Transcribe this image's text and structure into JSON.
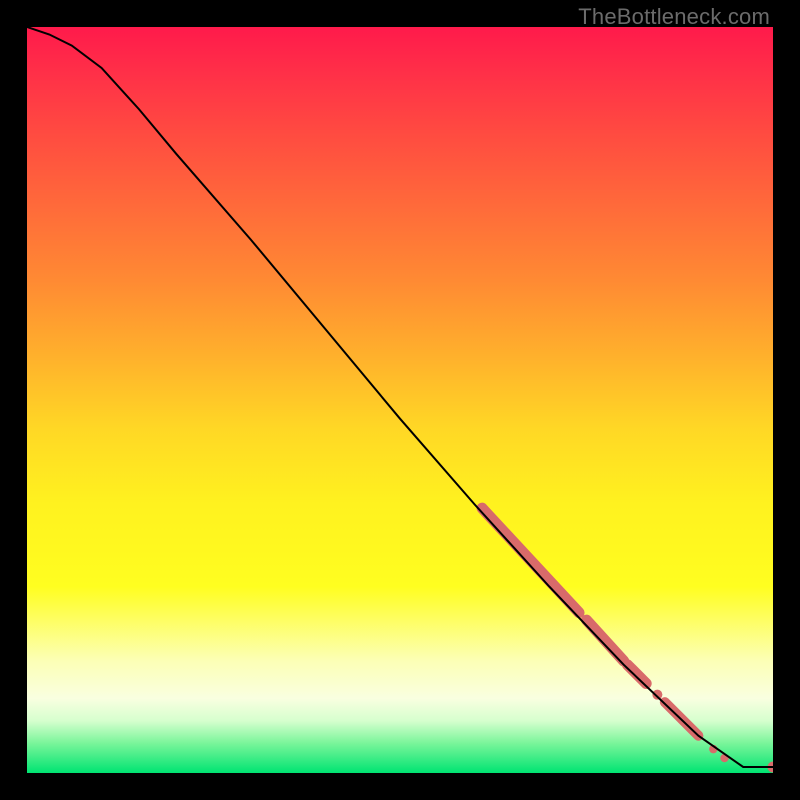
{
  "attribution": "TheBottleneck.com",
  "chart_data": {
    "type": "line",
    "title": "",
    "xlabel": "",
    "ylabel": "",
    "xlim": [
      0,
      100
    ],
    "ylim": [
      0,
      100
    ],
    "series": [
      {
        "name": "curve",
        "x": [
          0,
          3,
          6,
          10,
          15,
          20,
          30,
          40,
          50,
          60,
          70,
          80,
          90,
          96,
          100
        ],
        "y": [
          100,
          99,
          97.5,
          94.5,
          89,
          83,
          71.5,
          59.5,
          47.5,
          36,
          25,
          14.5,
          5,
          0.8,
          0.8
        ]
      }
    ],
    "markers": [
      {
        "name": "segment",
        "x0": 61,
        "y0": 35.5,
        "x1": 74,
        "y1": 21.5,
        "radius": 5.5
      },
      {
        "name": "segment",
        "x0": 75,
        "y0": 20.5,
        "x1": 80,
        "y1": 15,
        "radius": 5.5
      },
      {
        "name": "segment",
        "x0": 80.5,
        "y0": 14.5,
        "x1": 83,
        "y1": 12,
        "radius": 5.5
      },
      {
        "name": "point",
        "x": 84.5,
        "y": 10.5,
        "radius": 5.0
      },
      {
        "name": "segment",
        "x0": 85.5,
        "y0": 9.5,
        "x1": 90,
        "y1": 5,
        "radius": 5.0
      },
      {
        "name": "point",
        "x": 92,
        "y": 3.2,
        "radius": 4.2
      },
      {
        "name": "point",
        "x": 93.5,
        "y": 2.0,
        "radius": 4.2
      },
      {
        "name": "point",
        "x": 100,
        "y": 0.8,
        "radius": 5.5
      }
    ],
    "colors": {
      "line": "#000000",
      "marker": "#d86a6a"
    }
  }
}
